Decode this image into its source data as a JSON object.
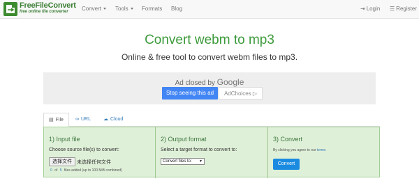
{
  "brand": {
    "name": "FreeFileConvert",
    "tagline": "free online file converter",
    "accent": "#3a7d33"
  },
  "nav": {
    "items": [
      {
        "label": "Convert",
        "dropdown": true
      },
      {
        "label": "Tools",
        "dropdown": true
      },
      {
        "label": "Formats",
        "dropdown": false
      },
      {
        "label": "Blog",
        "dropdown": false
      }
    ],
    "login_label": "Login",
    "register_label": "Register",
    "login_icon": "sign-in-icon",
    "register_icon": "user-icon"
  },
  "hero": {
    "title": "Convert webm to mp3",
    "subtitle": "Online & free tool to convert webm files to mp3.",
    "title_color": "#3c9a3a"
  },
  "ad": {
    "closed_text": "Ad closed by",
    "closed_brand": "Google",
    "stop_button": "Stop seeing this ad",
    "choices_button": "AdChoices",
    "choices_icon": "adchoices-triangle-icon"
  },
  "tabs": [
    {
      "label": "File",
      "icon": "file-icon",
      "active": true
    },
    {
      "label": "URL",
      "icon": "link-icon",
      "active": false
    },
    {
      "label": "Cloud",
      "icon": "cloud-icon",
      "active": false
    }
  ],
  "steps": {
    "input": {
      "heading": "1) Input file",
      "instruction": "Choose source file(s) to convert:",
      "choose_button": "选择文件",
      "no_file_text": "未选择任何文件",
      "files_added_count": "0",
      "files_of": "of",
      "files_max": "5",
      "files_added_suffix": "files added (up to 100 MiB combined)"
    },
    "output": {
      "heading": "2) Output format",
      "instruction": "Select a target format to convert to:",
      "select_value": "Convert files to:"
    },
    "convert": {
      "heading": "3) Convert",
      "agree_text": "By clicking you agree to our",
      "terms_link": "terms",
      "convert_button": "Convert"
    }
  },
  "colors": {
    "panel_bg": "#dff0d8",
    "panel_border": "#a4cf94",
    "primary_button": "#1a8be0",
    "google_button": "#4285f4"
  }
}
